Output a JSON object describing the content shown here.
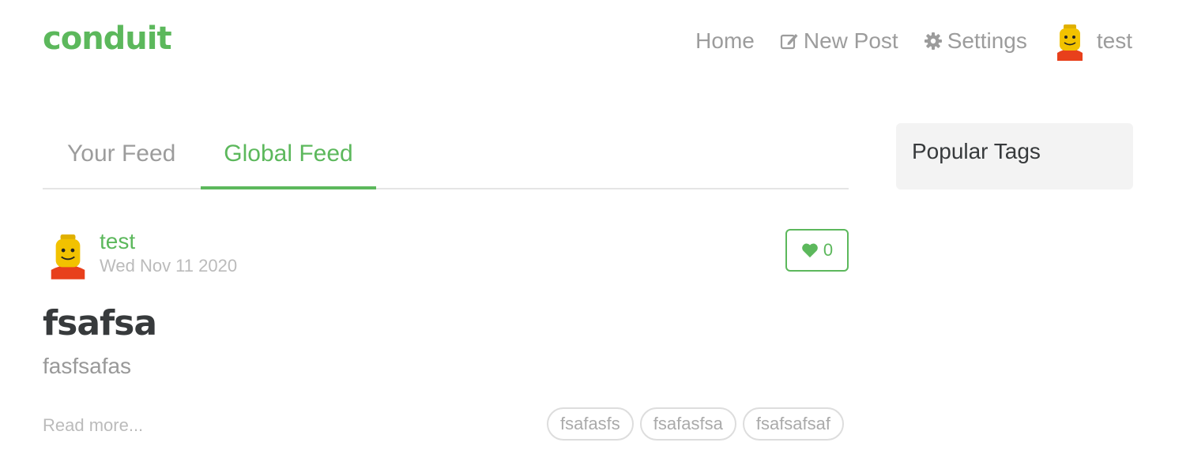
{
  "navbar": {
    "brand": "conduit",
    "items": [
      {
        "label": "Home",
        "icon": ""
      },
      {
        "label": "New Post",
        "icon": "edit-icon"
      },
      {
        "label": "Settings",
        "icon": "gear-icon"
      },
      {
        "label": "test",
        "icon": "avatar"
      }
    ]
  },
  "feed": {
    "tabs": [
      {
        "label": "Your Feed",
        "active": false
      },
      {
        "label": "Global Feed",
        "active": true
      }
    ],
    "article": {
      "author": "test",
      "date": "Wed Nov 11 2020",
      "likes": "0",
      "title": "fsafsa",
      "description": "fasfsafas",
      "read_more": "Read more...",
      "tags": [
        "fsafasfs",
        "fsafasfsa",
        "fsafsafsaf"
      ]
    }
  },
  "sidebar": {
    "title": "Popular Tags"
  },
  "colors": {
    "accent": "#5cb85c",
    "muted": "#9c9c9c",
    "sidebar_bg": "#f3f3f3"
  }
}
